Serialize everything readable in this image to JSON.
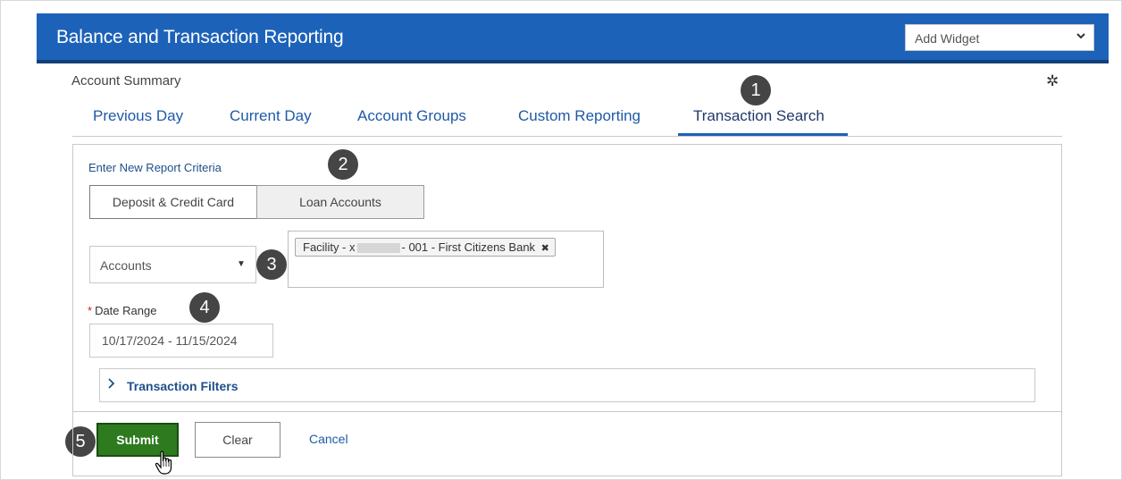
{
  "header": {
    "title": "Balance and Transaction Reporting",
    "widget_select": {
      "value": "Add Widget",
      "icon": "chevron-down-icon"
    }
  },
  "summary": {
    "title": "Account Summary",
    "settings_icon": "gear-icon"
  },
  "tabs": [
    {
      "label": "Previous Day",
      "active": false
    },
    {
      "label": "Current Day",
      "active": false
    },
    {
      "label": "Account Groups",
      "active": false
    },
    {
      "label": "Custom Reporting",
      "active": false
    },
    {
      "label": "Transaction Search",
      "active": true
    }
  ],
  "steps": [
    "1",
    "2",
    "3",
    "4",
    "5"
  ],
  "criteria": {
    "heading": "Enter New Report Criteria",
    "segments": [
      "Deposit & Credit Card",
      "Loan Accounts"
    ],
    "selected_segment": "Loan Accounts"
  },
  "accounts": {
    "placeholder": "Accounts",
    "selected_tag": {
      "prefix": "Facility - x",
      "suffix": "- 001 - First Citizens Bank",
      "remove_glyph": "✖"
    }
  },
  "date_range": {
    "required_marker": "*",
    "label": "Date Range",
    "value": "10/17/2024 - 11/15/2024"
  },
  "filters": {
    "label": "Transaction Filters",
    "icon": "chevron-right-icon"
  },
  "actions": {
    "submit": "Submit",
    "clear": "Clear",
    "cancel": "Cancel"
  },
  "colors": {
    "header": "#1c62b9",
    "submit": "#2d7a1f",
    "link": "#1f5aa6"
  }
}
